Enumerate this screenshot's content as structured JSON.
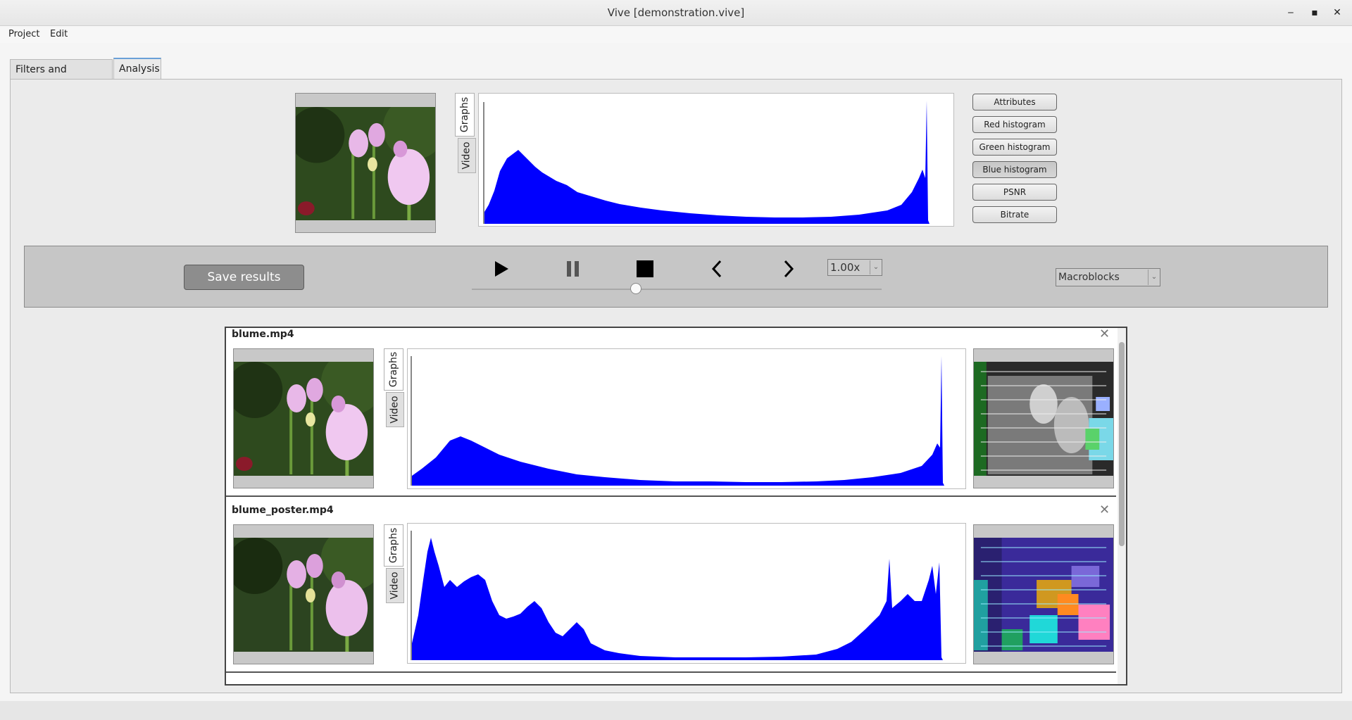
{
  "window": {
    "title": "Vive [demonstration.vive]",
    "minimize": "‒",
    "maximize": "▪",
    "close": "✕"
  },
  "menu": {
    "project": "Project",
    "edit": "Edit"
  },
  "tabs": {
    "filters": "Filters and artefacts",
    "analysis": "Analysis"
  },
  "preview": {
    "tab_graphs": "Graphs",
    "tab_video": "Video",
    "histogram_color": "#0000ff"
  },
  "graph_buttons": [
    "Attributes",
    "Red histogram",
    "Green histogram",
    "Blue histogram",
    "PSNR",
    "Bitrate"
  ],
  "selected_graph": "Blue histogram",
  "controls": {
    "save": "Save results",
    "speed": "1.00x",
    "mode": "Macroblocks",
    "play_icon": "play-icon",
    "pause_icon": "pause-icon",
    "stop_icon": "stop-icon",
    "prev_icon": "chevron-left-icon",
    "next_icon": "chevron-right-icon"
  },
  "videos": [
    {
      "name": "blume.mp4",
      "tab_graphs": "Graphs",
      "tab_video": "Video"
    },
    {
      "name": "blume_poster.mp4",
      "tab_graphs": "Graphs",
      "tab_video": "Video"
    }
  ],
  "close_icon": "close-icon"
}
